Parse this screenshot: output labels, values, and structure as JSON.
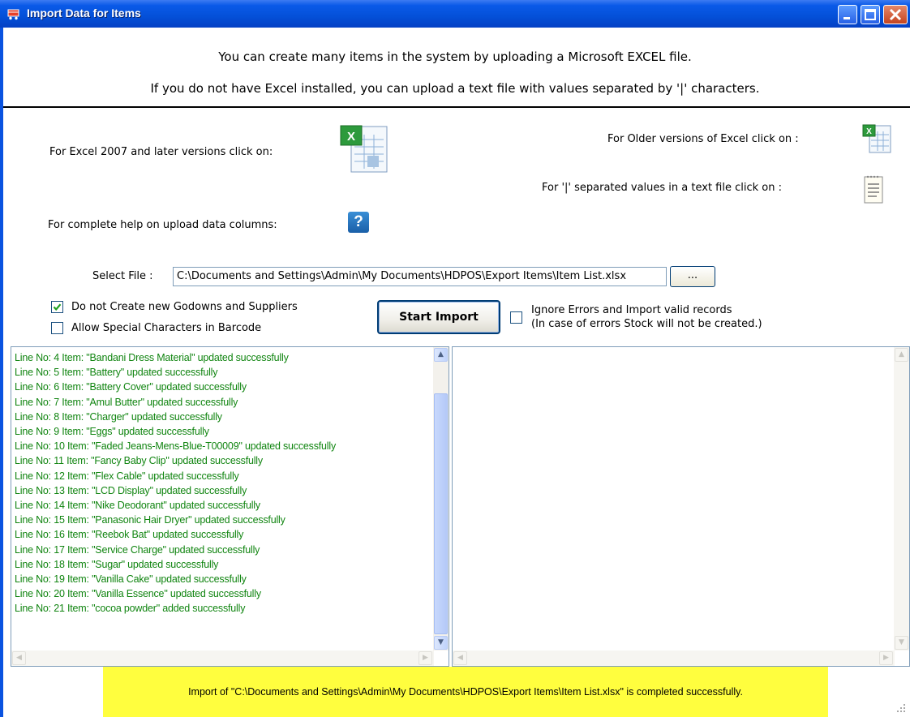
{
  "window": {
    "title": "Import Data for Items",
    "title_icon": "shopping-cart-icon"
  },
  "intro": {
    "line1": "You can create many items in the system by uploading a Microsoft EXCEL file.",
    "line2": "If you do not have Excel installed, you can upload a text file with values separated by '|' characters."
  },
  "options": {
    "excel2007_label": "For Excel 2007 and later versions click on:",
    "older_excel_label": "For Older versions of Excel click on :",
    "text_file_label": "For '|' separated  values in a text file click on :",
    "help_label": "For complete help on upload data columns:",
    "help_icon_text": "?"
  },
  "file": {
    "label": "Select File :",
    "value": "C:\\Documents and Settings\\Admin\\My Documents\\HDPOS\\Export Items\\Item List.xlsx",
    "browse_label": "..."
  },
  "checkboxes": {
    "no_create_godowns": {
      "label": "Do not Create new Godowns and Suppliers",
      "checked": true
    },
    "allow_special_chars": {
      "label": "Allow Special Characters in Barcode",
      "checked": false
    },
    "ignore_errors": {
      "label_line1": "Ignore Errors and Import valid records",
      "label_line2": "(In case of errors Stock will not be created.)",
      "checked": false
    }
  },
  "start_button": "Start Import",
  "log_lines": [
    "Line No: 4 Item: \"Bandani Dress Material\" updated successfully",
    "Line No: 5 Item: \"Battery\" updated successfully",
    "Line No: 6 Item: \"Battery Cover\" updated successfully",
    "Line No: 7 Item: \"Amul Butter\" updated successfully",
    "Line No: 8 Item: \"Charger\" updated successfully",
    "Line No: 9 Item: \"Eggs\" updated successfully",
    "Line No: 10 Item: \"Faded Jeans-Mens-Blue-T00009\" updated successfully",
    "Line No: 11 Item: \"Fancy Baby Clip\" updated successfully",
    "Line No: 12 Item: \"Flex Cable\" updated successfully",
    "Line No: 13 Item: \"LCD Display\" updated successfully",
    "Line No: 14 Item: \"Nike Deodorant\" updated successfully",
    "Line No: 15 Item: \"Panasonic Hair Dryer\" updated successfully",
    "Line No: 16 Item: \"Reebok Bat\" updated successfully",
    "Line No: 17 Item: \"Service Charge\" updated successfully",
    "Line No: 18 Item: \"Sugar\" updated successfully",
    "Line No: 19 Item: \"Vanilla Cake\" updated successfully",
    "Line No: 20 Item: \"Vanilla Essence\" updated successfully",
    "Line No: 21 Item: \"cocoa powder\" added successfully"
  ],
  "status": "Import of \"C:\\Documents and Settings\\Admin\\My Documents\\HDPOS\\Export Items\\Item List.xlsx\" is completed successfully.",
  "colors": {
    "log_text": "#118511",
    "status_bg": "#fffe3e",
    "titlebar": "#0450d8"
  }
}
